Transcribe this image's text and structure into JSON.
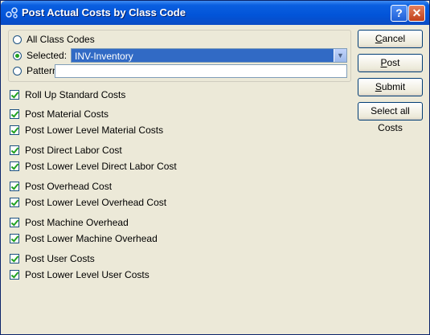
{
  "window": {
    "title": "Post Actual Costs by Class Code",
    "icons": {
      "app": "class-code-icon",
      "help": "help-icon",
      "close": "close-icon"
    },
    "help_glyph": "?",
    "close_glyph": "✕"
  },
  "selection": {
    "all_label": "All Class Codes",
    "selected_label": "Selected:",
    "pattern_label": "Pattern:",
    "mode": "selected",
    "selected_value": "INV-Inventory",
    "pattern_value": ""
  },
  "options": [
    {
      "key": "rollup",
      "label": "Roll Up Standard Costs",
      "checked": true
    },
    {
      "key": "material",
      "label": "Post Material Costs",
      "checked": true
    },
    {
      "key": "lower_material",
      "label": "Post Lower Level Material Costs",
      "checked": true
    },
    {
      "key": "direct_labor",
      "label": "Post Direct Labor Cost",
      "checked": true
    },
    {
      "key": "lower_direct_labor",
      "label": "Post Lower Level Direct Labor Cost",
      "checked": true
    },
    {
      "key": "overhead",
      "label": "Post Overhead Cost",
      "checked": true
    },
    {
      "key": "lower_overhead",
      "label": "Post Lower Level Overhead Cost",
      "checked": true
    },
    {
      "key": "machine_overhead",
      "label": "Post Machine Overhead",
      "checked": true
    },
    {
      "key": "lower_machine_overhead",
      "label": "Post Lower Machine Overhead",
      "checked": true
    },
    {
      "key": "user_costs",
      "label": "Post User Costs",
      "checked": true
    },
    {
      "key": "lower_user_costs",
      "label": "Post Lower Level User Costs",
      "checked": true
    }
  ],
  "buttons": {
    "cancel": {
      "mnemonic": "C",
      "rest": "ancel"
    },
    "post": {
      "mnemonic": "P",
      "rest": "ost"
    },
    "submit": {
      "mnemonic": "S",
      "rest": "ubmit"
    },
    "select_all": {
      "mnemonic": "",
      "rest": "Select all Costs"
    }
  },
  "colors": {
    "accent": "#21a121",
    "titlebar": "#0254d8",
    "selection": "#316ac5"
  }
}
